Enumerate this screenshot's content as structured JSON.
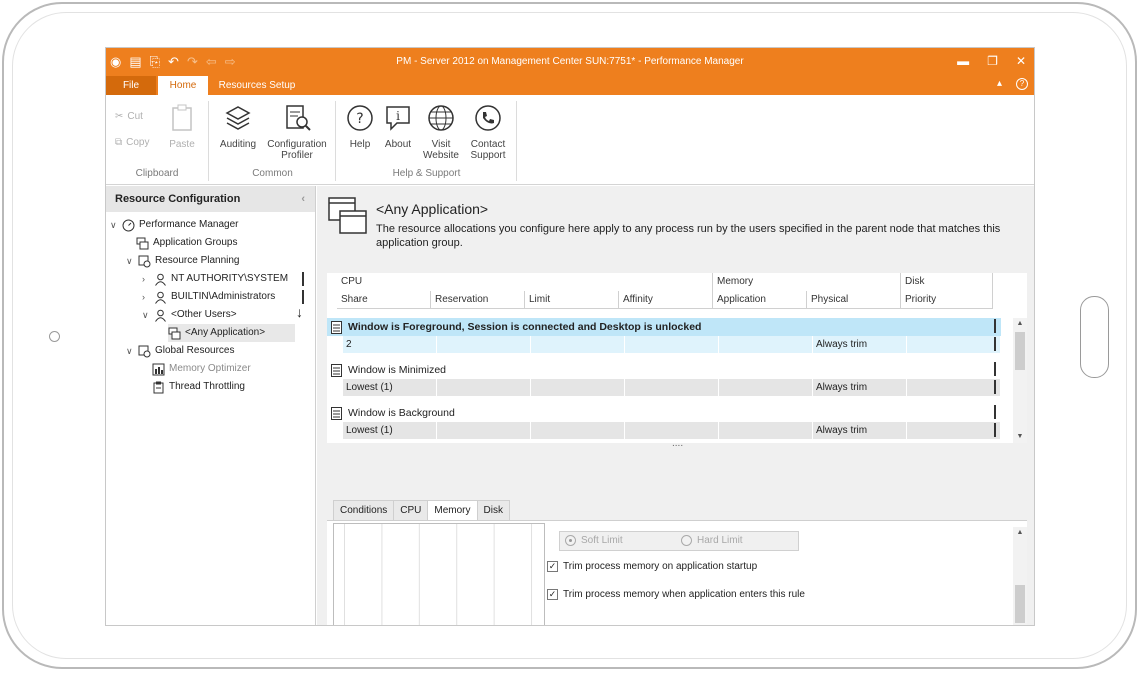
{
  "window": {
    "title": "PM - Server 2012 on Management Center SUN:7751* - Performance Manager"
  },
  "ribbon": {
    "tabs": {
      "file": "File",
      "home": "Home",
      "resources": "Resources Setup"
    },
    "clipboard": {
      "cut": "Cut",
      "copy": "Copy",
      "paste": "Paste",
      "group": "Clipboard"
    },
    "common": {
      "auditing": "Auditing",
      "config_line1": "Configuration",
      "config_line2": "Profiler",
      "group": "Common"
    },
    "help": {
      "help": "Help",
      "about": "About",
      "visit_line1": "Visit",
      "visit_line2": "Website",
      "contact_line1": "Contact",
      "contact_line2": "Support",
      "group": "Help & Support"
    }
  },
  "left_panel": {
    "title": "Resource Configuration",
    "tree": [
      {
        "label": "Performance Manager"
      },
      {
        "label": "Application Groups"
      },
      {
        "label": "Resource Planning"
      },
      {
        "label": "NT AUTHORITY\\SYSTEM"
      },
      {
        "label": "BUILTIN\\Administrators"
      },
      {
        "label": "<Other Users>"
      },
      {
        "label": "<Any Application>"
      },
      {
        "label": "Global Resources"
      },
      {
        "label": "Memory Optimizer"
      },
      {
        "label": "Thread Throttling"
      }
    ]
  },
  "main": {
    "title": "<Any Application>",
    "description": "The resource allocations you configure here apply to any process run by the users specified in the parent node that matches this application group."
  },
  "grid": {
    "groups": [
      "CPU",
      "Memory",
      "Disk"
    ],
    "columns": [
      "Share",
      "Reservation",
      "Limit",
      "Affinity",
      "Application",
      "Physical",
      "Priority"
    ],
    "rules": [
      {
        "name": "Window is Foreground, Session is connected and Desktop is unlocked",
        "share": "2",
        "physical": "Always trim"
      },
      {
        "name": "Window is Minimized",
        "share": "Lowest (1)",
        "physical": "Always trim"
      },
      {
        "name": "Window is Background",
        "share": "Lowest (1)",
        "physical": "Always trim"
      }
    ],
    "more_indicator": "...."
  },
  "bottom_tabs": [
    "Conditions",
    "CPU",
    "Memory",
    "Disk"
  ],
  "memory_tab": {
    "soft_limit": "Soft Limit",
    "hard_limit": "Hard Limit",
    "trim_startup": "Trim process memory on application startup",
    "trim_rule": "Trim process memory when application enters this rule",
    "axis_ticks": [
      "0",
      "0.2",
      "0.4",
      "0.6",
      "0.8",
      "1"
    ]
  },
  "colors": {
    "accent": "#ee7f1e",
    "selected_row": "#bfe6f8"
  }
}
